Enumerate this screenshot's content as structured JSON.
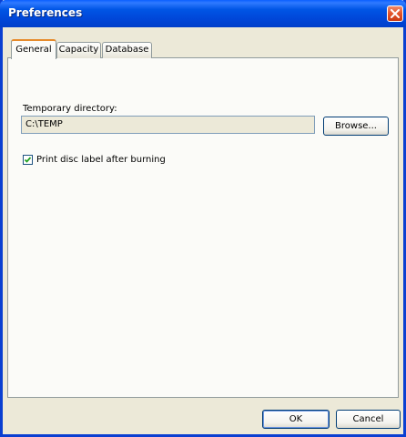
{
  "window": {
    "title": "Preferences",
    "close_icon": "close-icon"
  },
  "tabs": [
    {
      "label": "General",
      "active": true
    },
    {
      "label": "Capacity",
      "active": false
    },
    {
      "label": "Database",
      "active": false
    }
  ],
  "general": {
    "temp_dir_label": "Temporary directory:",
    "temp_dir_value": "C:\\TEMP",
    "browse_label": "Browse...",
    "print_label_checkbox": "Print disc label after burning",
    "print_label_checked": true
  },
  "footer": {
    "ok_label": "OK",
    "cancel_label": "Cancel"
  },
  "colors": {
    "titlebar": "#0055e5",
    "active_tab_accent": "#e68b2c",
    "checkmark": "#21a121"
  }
}
